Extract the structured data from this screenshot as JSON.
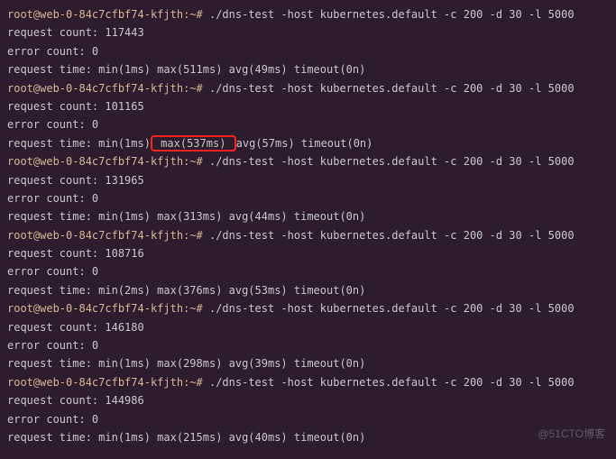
{
  "prompt": "root@web-0-84c7cfbf74-kfjth:~# ",
  "command": "./dns-test -host kubernetes.default -c 200 -d 30 -l 5000",
  "runs": [
    {
      "request_count": "request count: 117443",
      "error_count": "error count: 0",
      "time_pre": "request time: min(1ms) max(511ms) avg(49ms) timeout(0n)",
      "highlighted": false
    },
    {
      "request_count": "request count: 101165",
      "error_count": "error count: 0",
      "time_pre": "request time: min(1ms)",
      "time_highlight": " max(537ms) ",
      "time_post": "avg(57ms) timeout(0n)",
      "highlighted": true
    },
    {
      "request_count": "request count: 131965",
      "error_count": "error count: 0",
      "time_pre": "request time: min(1ms) max(313ms) avg(44ms) timeout(0n)",
      "highlighted": false
    },
    {
      "request_count": "request count: 108716",
      "error_count": "error count: 0",
      "time_pre": "request time: min(2ms) max(376ms) avg(53ms) timeout(0n)",
      "highlighted": false
    },
    {
      "request_count": "request count: 146180",
      "error_count": "error count: 0",
      "time_pre": "request time: min(1ms) max(298ms) avg(39ms) timeout(0n)",
      "highlighted": false
    },
    {
      "request_count": "request count: 144986",
      "error_count": "error count: 0",
      "time_pre": "request time: min(1ms) max(215ms) avg(40ms) timeout(0n)",
      "highlighted": false
    }
  ],
  "watermark": "@51CTO博客"
}
